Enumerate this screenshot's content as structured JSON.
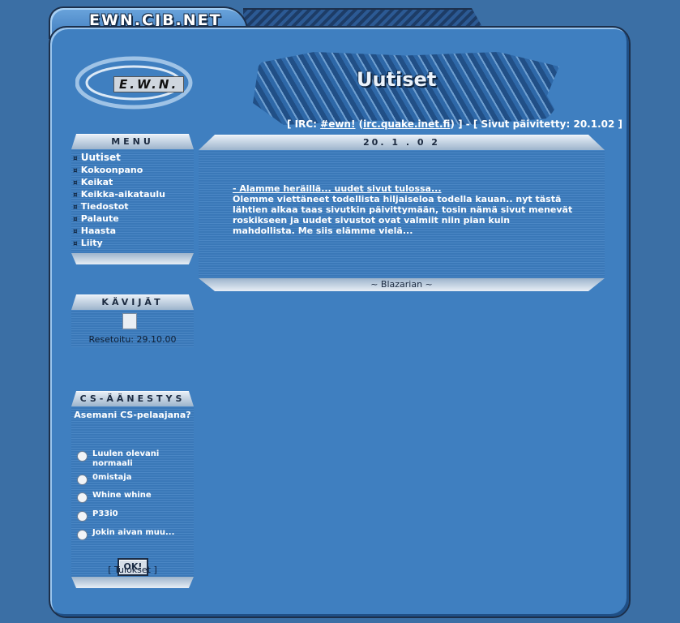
{
  "site": {
    "tab_title": "EWN.CJB.NET",
    "logo_text": "E.W.N.",
    "banner_title": "Uutiset"
  },
  "info": {
    "prefix": "[ IRC: ",
    "channel": "#ewn!",
    "open_paren": " (",
    "server": "irc.quake.inet.fi",
    "close": ") ] - [ Sivut päivitetty: 20.1.02 ]"
  },
  "menu": {
    "title": "MENU",
    "items": [
      {
        "label": "Uutiset"
      },
      {
        "label": "Kokoonpano"
      },
      {
        "label": "Keikat"
      },
      {
        "label": "Keikka-aikataulu"
      },
      {
        "label": "Tiedostot"
      },
      {
        "label": "Palaute"
      },
      {
        "label": "Haasta"
      },
      {
        "label": "Liity"
      }
    ],
    "bullet": "¤"
  },
  "visitors": {
    "title": "KÄVIJÄT",
    "reset_text": "Resetoitu: 29.10.00"
  },
  "poll": {
    "title": "CS-ÄÄNESTYS",
    "question": "Asemani CS-pelaajana?",
    "options": [
      {
        "label": "Luulen olevani normaali"
      },
      {
        "label": "0mistaja"
      },
      {
        "label": "Whine whine"
      },
      {
        "label": "P33i0"
      },
      {
        "label": "Jokin aivan muu..."
      }
    ],
    "ok_label": "OK!",
    "results_label": "[ Tulokset ]"
  },
  "news": {
    "date": "20. 1 . 0 2",
    "headline": "- Alamme heräillä... uudet sivut tulossa...",
    "body": "Olemme viettäneet todellista hiljaiseloa todella kauan.. nyt tästä lähtien alkaa taas sivutkin päivittymään, tosin nämä sivut menevät roskikseen ja uudet sivustot ovat valmiit niin pian kuin mahdollista. Me siis elämme vielä...",
    "signature": "~ Blazarian ~"
  }
}
